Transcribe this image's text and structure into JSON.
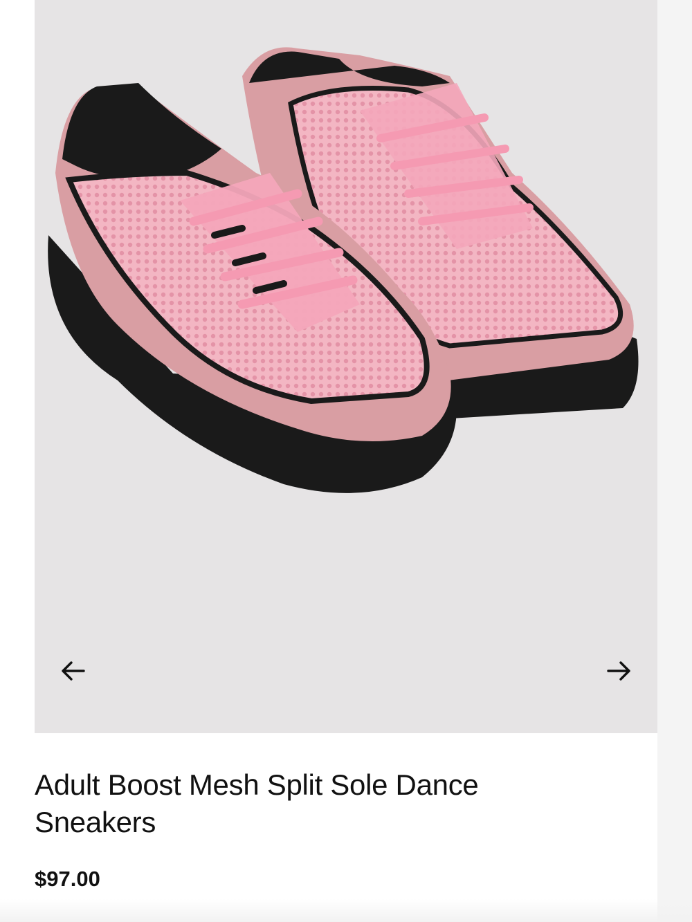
{
  "product": {
    "title": "Adult Boost Mesh Split Sole Dance Sneakers",
    "price": "$97.00"
  },
  "gallery": {
    "image_alt_icon": "pink-mesh-sneakers-image",
    "prev_icon": "arrow-left-icon",
    "next_icon": "arrow-right-icon"
  },
  "colors": {
    "gallery_background": "#e6e4e5",
    "shoe_pink": "#efa7b6",
    "shoe_suede": "#d99ea3",
    "shoe_black": "#1a1a1a",
    "text": "#111111"
  }
}
